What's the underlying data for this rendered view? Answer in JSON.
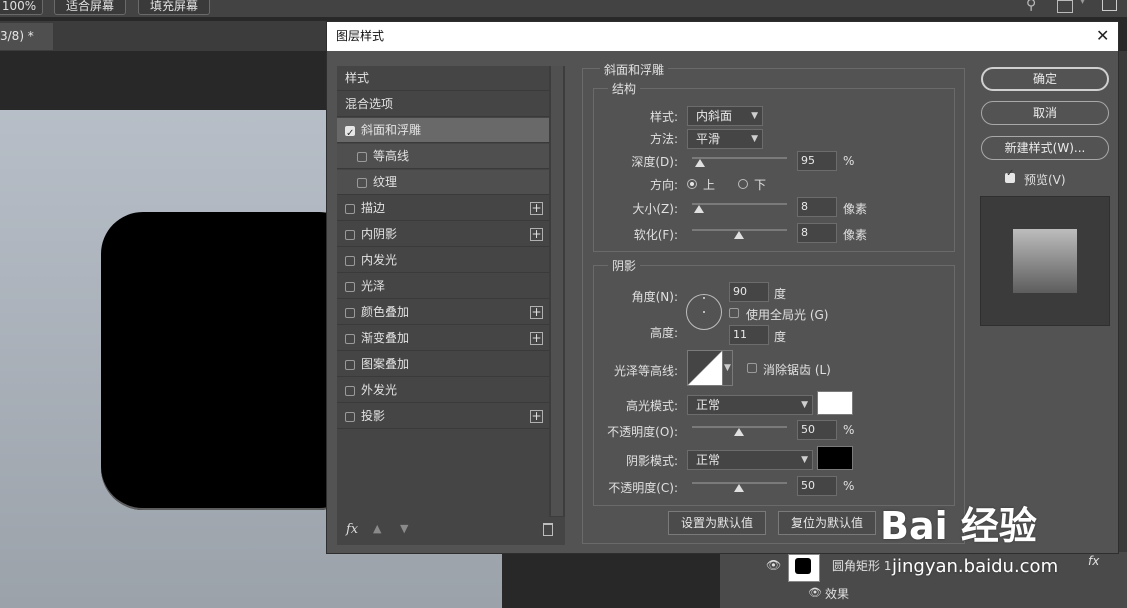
{
  "toolbar": {
    "zoom": "100%",
    "fit_screen": "适合屏幕",
    "fill_screen": "填充屏幕"
  },
  "doc_tab": {
    "label": "3/8) *",
    "close": "×"
  },
  "dialog": {
    "title": "图层样式",
    "close": "✕"
  },
  "styles_panel": {
    "items": [
      {
        "label": "样式",
        "checkbox": false,
        "plus": false
      },
      {
        "label": "混合选项",
        "checkbox": false,
        "plus": false
      },
      {
        "label": "斜面和浮雕",
        "checkbox": true,
        "checked": true,
        "selected": true
      },
      {
        "label": "等高线",
        "checkbox": true,
        "checked": false,
        "sub": true
      },
      {
        "label": "纹理",
        "checkbox": true,
        "checked": false,
        "sub": true
      },
      {
        "label": "描边",
        "checkbox": true,
        "checked": false,
        "plus": true
      },
      {
        "label": "内阴影",
        "checkbox": true,
        "checked": false,
        "plus": true
      },
      {
        "label": "内发光",
        "checkbox": true,
        "checked": false
      },
      {
        "label": "光泽",
        "checkbox": true,
        "checked": false
      },
      {
        "label": "颜色叠加",
        "checkbox": true,
        "checked": false,
        "plus": true
      },
      {
        "label": "渐变叠加",
        "checkbox": true,
        "checked": false,
        "plus": true
      },
      {
        "label": "图案叠加",
        "checkbox": true,
        "checked": false
      },
      {
        "label": "外发光",
        "checkbox": true,
        "checked": false
      },
      {
        "label": "投影",
        "checkbox": true,
        "checked": false,
        "plus": true
      }
    ],
    "fx": "fx"
  },
  "bevel": {
    "group_title": "斜面和浮雕",
    "structure_title": "结构",
    "style_label": "样式:",
    "style_value": "内斜面",
    "technique_label": "方法:",
    "technique_value": "平滑",
    "depth_label": "深度(D):",
    "depth_value": "95",
    "depth_unit": "%",
    "direction_label": "方向:",
    "direction_up": "上",
    "direction_down": "下",
    "size_label": "大小(Z):",
    "size_value": "8",
    "size_unit": "像素",
    "soften_label": "软化(F):",
    "soften_value": "8",
    "soften_unit": "像素"
  },
  "shading": {
    "title": "阴影",
    "angle_label": "角度(N):",
    "angle_value": "90",
    "angle_unit": "度",
    "global_light": "使用全局光 (G)",
    "altitude_label": "高度:",
    "altitude_value": "11",
    "altitude_unit": "度",
    "gloss_label": "光泽等高线:",
    "antialias": "消除锯齿 (L)",
    "highlight_label": "高光模式:",
    "highlight_mode": "正常",
    "highlight_color": "#ffffff",
    "highlight_opacity_label": "不透明度(O):",
    "highlight_opacity": "50",
    "highlight_opacity_unit": "%",
    "shadow_label": "阴影模式:",
    "shadow_mode": "正常",
    "shadow_color": "#000000",
    "shadow_opacity_label": "不透明度(C):",
    "shadow_opacity": "50",
    "shadow_opacity_unit": "%"
  },
  "footer": {
    "make_default": "设置为默认值",
    "reset_default": "复位为默认值"
  },
  "buttons": {
    "ok": "确定",
    "cancel": "取消",
    "new_style": "新建样式(W)...",
    "preview": "预览(V)"
  },
  "layers": {
    "layer_name": "圆角矩形 1",
    "effects": "效果",
    "fx": "fx"
  },
  "watermark": {
    "text": "Bai 经验",
    "url": "jingyan.baidu.com"
  }
}
